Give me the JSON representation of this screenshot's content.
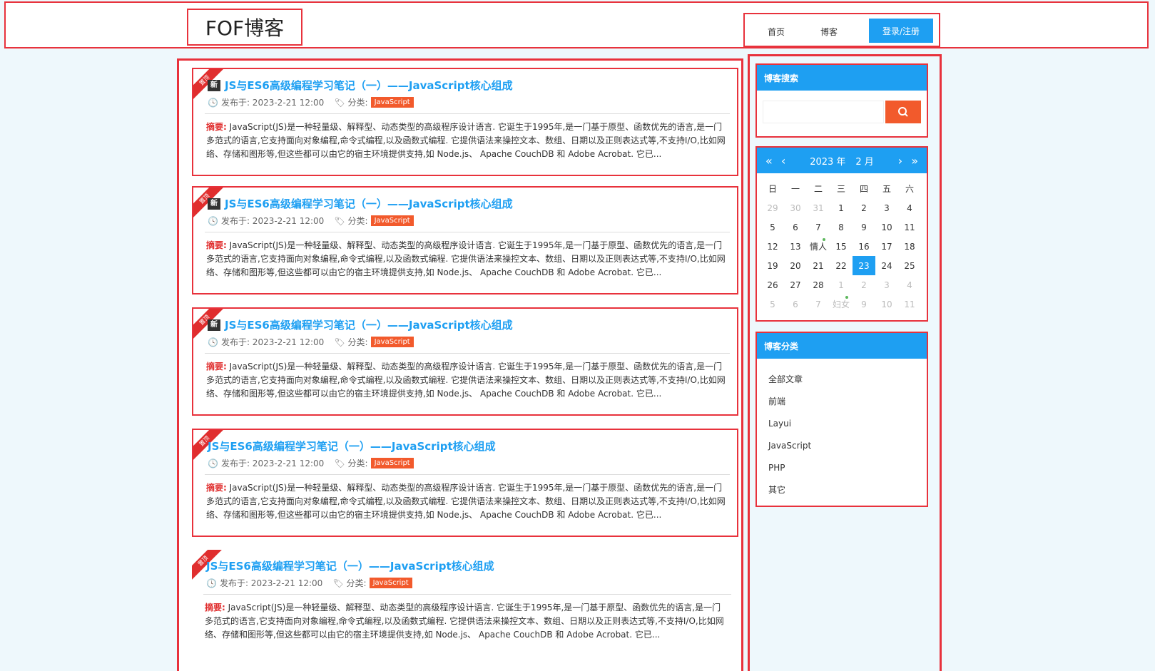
{
  "header": {
    "logo": "FOF博客",
    "nav": {
      "home": "首页",
      "blog": "博客",
      "login": "登录/注册"
    }
  },
  "posts": [
    {
      "ribbon": "置顶",
      "new_tag": "新",
      "title": "JS与ES6高级编程学习笔记（一）——JavaScript核心组成",
      "meta_date": "发布于: 2023-2-21 12:00",
      "meta_cat_label": "分类:",
      "category": "JavaScript",
      "summary_label": "摘要:",
      "summary": "JavaScript(JS)是一种轻量级、解释型、动态类型的高级程序设计语言. 它诞生于1995年,是一门基于原型、函数优先的语言,是一门多范式的语言,它支持面向对象编程,命令式编程,以及函数式编程. 它提供语法来操控文本、数组、日期以及正则表达式等,不支持I/O,比如网络、存储和图形等,但这些都可以由它的宿主环境提供支持,如 Node.js、 Apache CouchDB 和 Adobe Acrobat. 它已..."
    },
    {
      "ribbon": "置顶",
      "new_tag": "新",
      "title": "JS与ES6高级编程学习笔记（一）——JavaScript核心组成",
      "meta_date": "发布于: 2023-2-21 12:00",
      "meta_cat_label": "分类:",
      "category": "JavaScript",
      "summary_label": "摘要:",
      "summary": "JavaScript(JS)是一种轻量级、解释型、动态类型的高级程序设计语言. 它诞生于1995年,是一门基于原型、函数优先的语言,是一门多范式的语言,它支持面向对象编程,命令式编程,以及函数式编程. 它提供语法来操控文本、数组、日期以及正则表达式等,不支持I/O,比如网络、存储和图形等,但这些都可以由它的宿主环境提供支持,如 Node.js、 Apache CouchDB 和 Adobe Acrobat. 它已..."
    },
    {
      "ribbon": "置顶",
      "new_tag": "新",
      "title": "JS与ES6高级编程学习笔记（一）——JavaScript核心组成",
      "meta_date": "发布于: 2023-2-21 12:00",
      "meta_cat_label": "分类:",
      "category": "JavaScript",
      "summary_label": "摘要:",
      "summary": "JavaScript(JS)是一种轻量级、解释型、动态类型的高级程序设计语言. 它诞生于1995年,是一门基于原型、函数优先的语言,是一门多范式的语言,它支持面向对象编程,命令式编程,以及函数式编程. 它提供语法来操控文本、数组、日期以及正则表达式等,不支持I/O,比如网络、存储和图形等,但这些都可以由它的宿主环境提供支持,如 Node.js、 Apache CouchDB 和 Adobe Acrobat. 它已..."
    },
    {
      "ribbon": "置顶",
      "new_tag": "",
      "title": "JS与ES6高级编程学习笔记（一）——JavaScript核心组成",
      "meta_date": "发布于: 2023-2-21 12:00",
      "meta_cat_label": "分类:",
      "category": "JavaScript",
      "summary_label": "摘要:",
      "summary": "JavaScript(JS)是一种轻量级、解释型、动态类型的高级程序设计语言. 它诞生于1995年,是一门基于原型、函数优先的语言,是一门多范式的语言,它支持面向对象编程,命令式编程,以及函数式编程. 它提供语法来操控文本、数组、日期以及正则表达式等,不支持I/O,比如网络、存储和图形等,但这些都可以由它的宿主环境提供支持,如 Node.js、 Apache CouchDB 和 Adobe Acrobat. 它已..."
    },
    {
      "ribbon": "置顶",
      "new_tag": "",
      "title": "JS与ES6高级编程学习笔记（一）——JavaScript核心组成",
      "meta_date": "发布于: 2023-2-21 12:00",
      "meta_cat_label": "分类:",
      "category": "JavaScript",
      "summary_label": "摘要:",
      "summary": "JavaScript(JS)是一种轻量级、解释型、动态类型的高级程序设计语言. 它诞生于1995年,是一门基于原型、函数优先的语言,是一门多范式的语言,它支持面向对象编程,命令式编程,以及函数式编程. 它提供语法来操控文本、数组、日期以及正则表达式等,不支持I/O,比如网络、存储和图形等,但这些都可以由它的宿主环境提供支持,如 Node.js、 Apache CouchDB 和 Adobe Acrobat. 它已..."
    }
  ],
  "sidebar": {
    "search": {
      "title": "博客搜索",
      "placeholder": "",
      "icon": "search-icon"
    },
    "calendar": {
      "prev_year": "«",
      "prev_month": "‹",
      "next_month": "›",
      "next_year": "»",
      "year": "2023 年",
      "month": "2 月",
      "weekdays": [
        "日",
        "一",
        "二",
        "三",
        "四",
        "五",
        "六"
      ],
      "cells": [
        {
          "t": "29",
          "o": true
        },
        {
          "t": "30",
          "o": true
        },
        {
          "t": "31",
          "o": true
        },
        {
          "t": "1"
        },
        {
          "t": "2"
        },
        {
          "t": "3"
        },
        {
          "t": "4"
        },
        {
          "t": "5"
        },
        {
          "t": "6"
        },
        {
          "t": "7"
        },
        {
          "t": "8"
        },
        {
          "t": "9"
        },
        {
          "t": "10"
        },
        {
          "t": "11"
        },
        {
          "t": "12"
        },
        {
          "t": "13"
        },
        {
          "t": "情人",
          "m": true
        },
        {
          "t": "15"
        },
        {
          "t": "16"
        },
        {
          "t": "17"
        },
        {
          "t": "18"
        },
        {
          "t": "19"
        },
        {
          "t": "20"
        },
        {
          "t": "21"
        },
        {
          "t": "22"
        },
        {
          "t": "23",
          "today": true
        },
        {
          "t": "24"
        },
        {
          "t": "25"
        },
        {
          "t": "26"
        },
        {
          "t": "27"
        },
        {
          "t": "28"
        },
        {
          "t": "1",
          "o": true
        },
        {
          "t": "2",
          "o": true
        },
        {
          "t": "3",
          "o": true
        },
        {
          "t": "4",
          "o": true
        },
        {
          "t": "5",
          "o": true
        },
        {
          "t": "6",
          "o": true
        },
        {
          "t": "7",
          "o": true
        },
        {
          "t": "妇女",
          "o": true,
          "m": true
        },
        {
          "t": "9",
          "o": true
        },
        {
          "t": "10",
          "o": true
        },
        {
          "t": "11",
          "o": true
        }
      ]
    },
    "categories": {
      "title": "博客分类",
      "items": [
        "全部文章",
        "前端",
        "Layui",
        "JavaScript",
        "PHP",
        "其它"
      ]
    }
  },
  "colors": {
    "accent": "#1e9ff2",
    "highlight_border": "#e8323c",
    "badge": "#f25a2c",
    "ribbon": "#e02e2e"
  }
}
